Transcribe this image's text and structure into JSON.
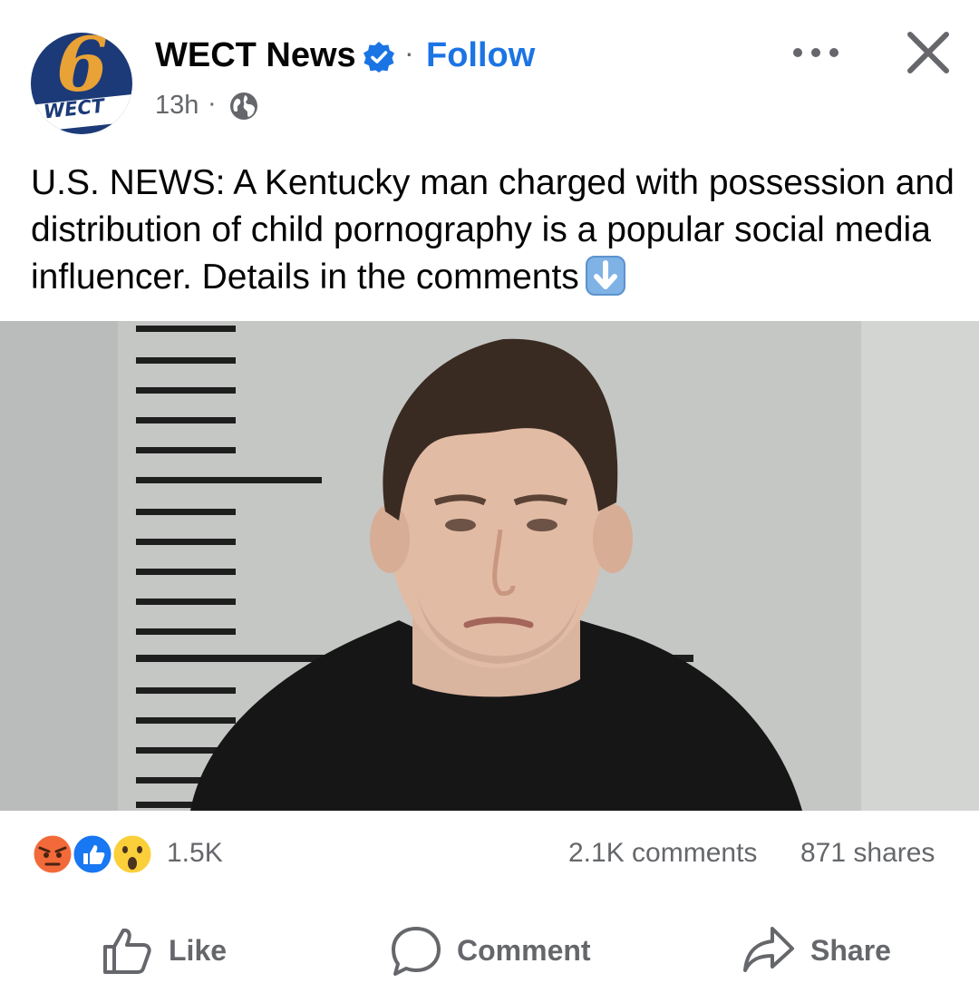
{
  "post": {
    "page_name": "WECT News",
    "avatar_logo_text": "WECT",
    "avatar_logo_number": "6",
    "separator": "·",
    "follow_label": "Follow",
    "time": "13h",
    "text": "U.S. NEWS:  A Kentucky man charged with possession and distribution of child pornography is a popular social media influencer. Details in the comments",
    "icons": {
      "verified": "verified-badge-icon",
      "audience": "globe-icon",
      "more": "more-options-icon",
      "close": "close-icon",
      "text_emoji": "down-arrow-emoji-icon"
    }
  },
  "stats": {
    "reactions": [
      "angry",
      "like",
      "wow"
    ],
    "reaction_count": "1.5K",
    "comments": "2.1K comments",
    "shares": "871 shares"
  },
  "actions": {
    "like": "Like",
    "comment": "Comment",
    "share": "Share"
  },
  "colors": {
    "accent": "#1b74e4",
    "secondary_text": "#65676b",
    "logo_blue": "#1c3a78",
    "logo_orange": "#e9a235"
  }
}
